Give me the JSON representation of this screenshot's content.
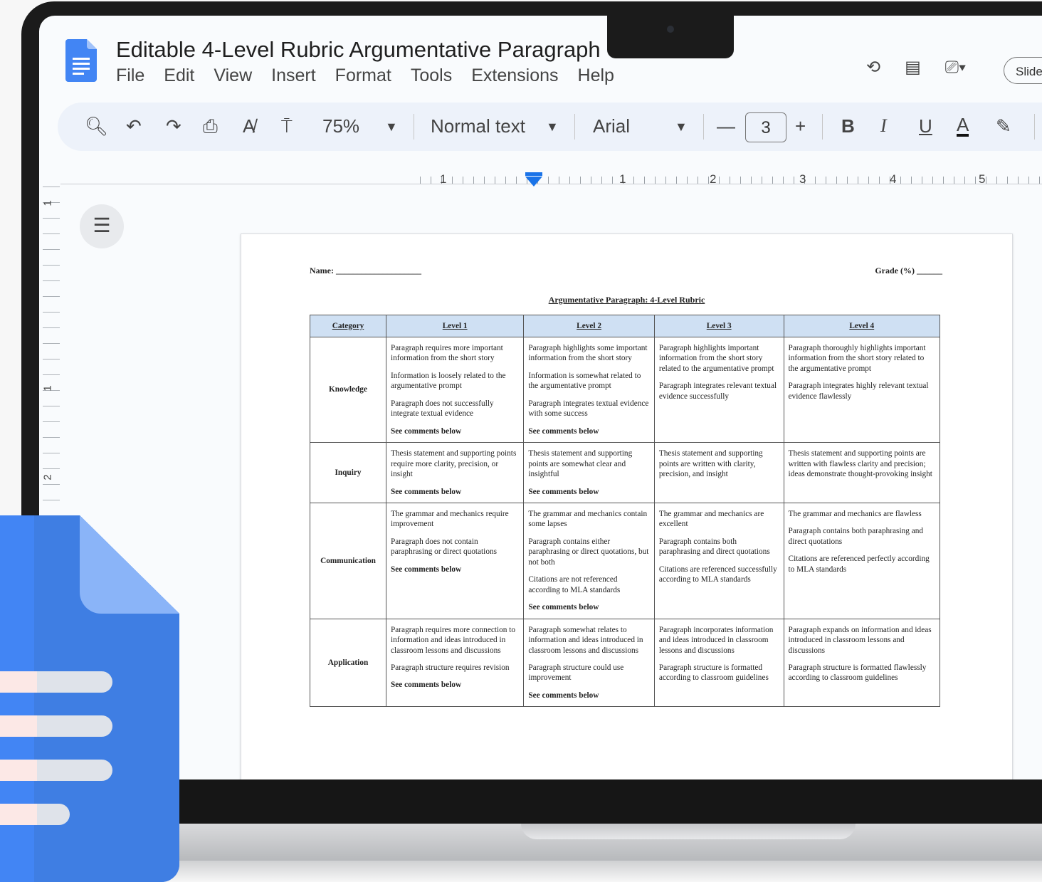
{
  "doc": {
    "title": "Editable 4-Level Rubric Argumentative Paragraph",
    "menu": [
      "File",
      "Edit",
      "View",
      "Insert",
      "Format",
      "Tools",
      "Extensions",
      "Help"
    ],
    "slides_label": "Slide"
  },
  "toolbar": {
    "zoom": "75%",
    "style": "Normal text",
    "font": "Arial",
    "minus": "—",
    "font_size": "3",
    "plus": "+",
    "bold": "B",
    "italic": "I",
    "underline": "U",
    "text_color": "A"
  },
  "ruler": {
    "numbers": [
      "1",
      "1",
      "2",
      "3",
      "4",
      "5"
    ],
    "vertical_numbers": [
      "1",
      "1",
      "2"
    ]
  },
  "page": {
    "name_label": "Name: ____________________",
    "grade_label": "Grade (%) ______",
    "rubric_title": "Argumentative Paragraph: 4-Level Rubric",
    "headers": [
      "Category",
      "Level 1",
      "Level 2",
      "Level 3",
      "Level 4"
    ],
    "rows": [
      {
        "category": "Knowledge",
        "cells": [
          [
            "Paragraph requires more important information from the short story",
            "Information is loosely related to the argumentative prompt",
            "Paragraph does not successfully integrate textual evidence",
            "See comments below"
          ],
          [
            "Paragraph highlights some important information from the short story",
            "Information is somewhat related to the argumentative prompt",
            "Paragraph integrates textual evidence with some success",
            "See comments below"
          ],
          [
            "Paragraph highlights important information from the short story related to the argumentative prompt",
            "Paragraph integrates relevant textual evidence successfully"
          ],
          [
            "Paragraph thoroughly highlights important information from the short story related to the argumentative prompt",
            "Paragraph integrates highly relevant textual evidence flawlessly"
          ]
        ]
      },
      {
        "category": "Inquiry",
        "cells": [
          [
            "Thesis statement and supporting points require more clarity, precision, or insight",
            "See comments below"
          ],
          [
            "Thesis statement and supporting points are somewhat clear and insightful",
            "See comments below"
          ],
          [
            "Thesis statement and supporting points are written with clarity, precision, and insight"
          ],
          [
            "Thesis statement and supporting points are written with flawless clarity and precision; ideas demonstrate thought-provoking insight"
          ]
        ]
      },
      {
        "category": "Communication",
        "cells": [
          [
            "The grammar and mechanics require improvement",
            "Paragraph does not contain paraphrasing or direct quotations",
            "See comments below"
          ],
          [
            "The grammar and mechanics contain some lapses",
            "Paragraph contains either paraphrasing or direct quotations, but not both",
            "Citations are not referenced according to MLA standards",
            "See comments below"
          ],
          [
            "The grammar and mechanics are excellent",
            "Paragraph contains both paraphrasing and direct quotations",
            "Citations are referenced successfully according to MLA standards"
          ],
          [
            "The grammar and mechanics are flawless",
            "Paragraph contains both paraphrasing and direct quotations",
            "Citations are referenced perfectly according to MLA standards"
          ]
        ]
      },
      {
        "category": "Application",
        "cells": [
          [
            "Paragraph requires more connection to information and ideas introduced in classroom lessons and discussions",
            "Paragraph structure requires revision",
            "See comments below"
          ],
          [
            "Paragraph somewhat relates to information and ideas introduced in classroom lessons and discussions",
            "Paragraph structure could use improvement",
            "See comments below"
          ],
          [
            "Paragraph incorporates information and ideas introduced in classroom lessons and discussions",
            "Paragraph structure is formatted according to classroom guidelines"
          ],
          [
            "Paragraph expands on information and ideas introduced in classroom lessons and discussions",
            "Paragraph structure is formatted flawlessly according to classroom guidelines"
          ]
        ]
      }
    ]
  },
  "icons": [
    "docs-logo-icon",
    "star-icon",
    "move-to-folder-icon",
    "cloud-saved-icon",
    "history-icon",
    "comments-icon",
    "meet-icon",
    "search-icon",
    "undo-icon",
    "redo-icon",
    "print-icon",
    "spellcheck-icon",
    "paint-format-icon",
    "highlighter-icon",
    "outline-icon"
  ],
  "colors": {
    "accent": "#1a73e8",
    "docs_blue": "#4285f4",
    "header_cell": "#cfe0f3",
    "toolbar_bg": "#edf2fa"
  }
}
